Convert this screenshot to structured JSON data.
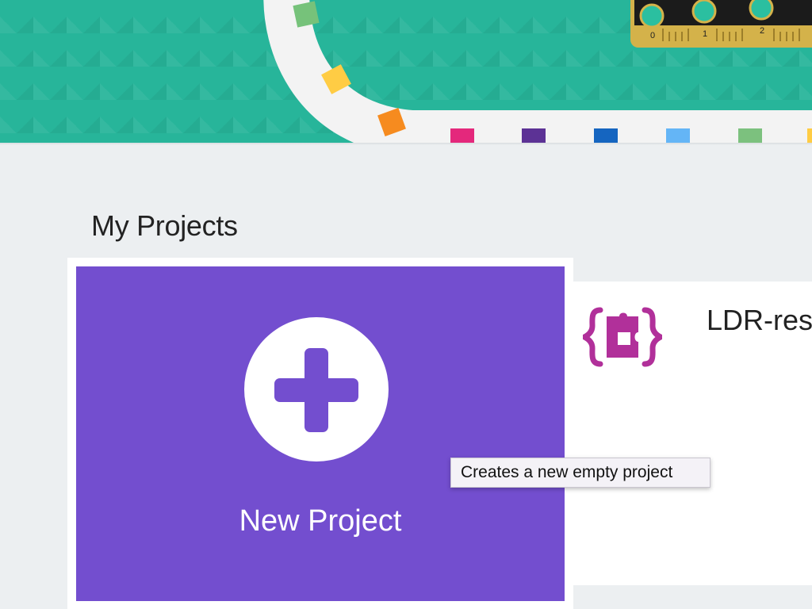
{
  "header": {
    "ruler_ticks": [
      "0",
      "1",
      "2"
    ],
    "colors": {
      "hero_bg": "#27b59a",
      "track": "#f3f3f3",
      "board": "#1b1b1b",
      "board_edge": "#d4b24a",
      "pad": "#2bbfa0",
      "blocks": [
        "#76c27a",
        "#ffcc44",
        "#f68b1f",
        "#e4287c",
        "#5c3295",
        "#1565c0",
        "#64b5f6",
        "#7cc17e"
      ]
    }
  },
  "main": {
    "section_title": "My Projects",
    "new_project": {
      "label": "New Project",
      "icon": "plus-icon",
      "tooltip": "Creates a new empty project",
      "color": "#734ecf"
    },
    "projects": [
      {
        "name": "LDR-res",
        "icon": "extension-puzzle-icon",
        "icon_color": "#b1309a"
      }
    ]
  }
}
